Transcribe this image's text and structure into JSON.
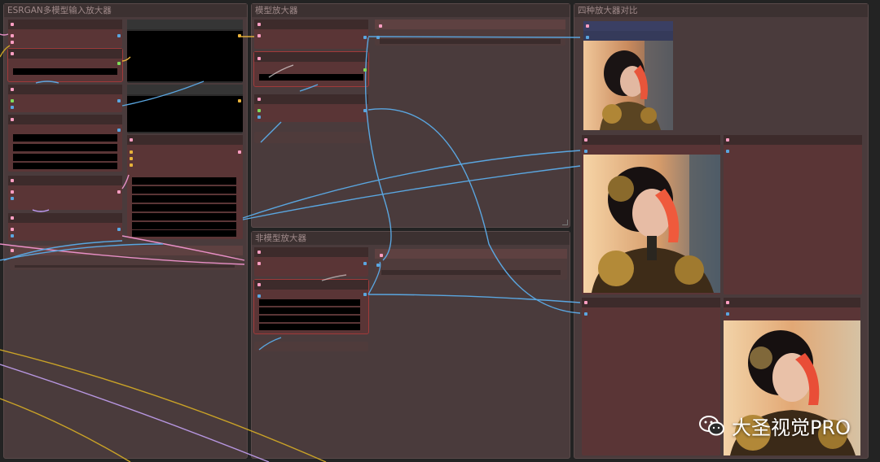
{
  "groups": {
    "esrgan": {
      "title": "ESRGAN多模型输入放大器"
    },
    "model": {
      "title": "模型放大器"
    },
    "nonmodel": {
      "title": "非模型放大器"
    },
    "compare": {
      "title": "四种放大器对比"
    }
  },
  "watermark": {
    "text": "大圣视觉PRO"
  },
  "colors": {
    "wire_blue": "#5aa6e0",
    "wire_yellow": "#c9a227",
    "wire_pink": "#e88fc6",
    "wire_purple": "#b796e0",
    "node_bg": "#5a3536",
    "group_bg": "#4a3b3c"
  }
}
